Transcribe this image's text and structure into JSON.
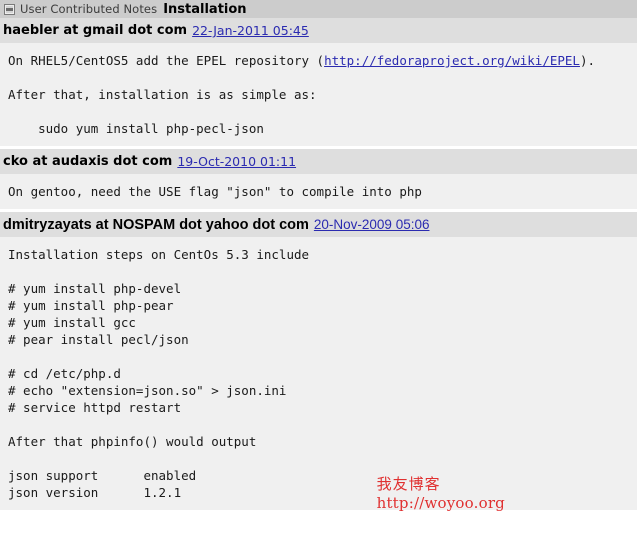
{
  "header": {
    "collapse_icon": "minus-box-icon",
    "notes_label": "User Contributed Notes",
    "page_title": "Installation"
  },
  "notes": [
    {
      "author": "haebler at gmail dot com",
      "date": "22-Jan-2011 05:45",
      "body_before_link": "On RHEL5/CentOS5 add the EPEL repository (",
      "link_text": "http://fedoraproject.org/wiki/EPEL",
      "body_after_link": ").\n\nAfter that, installation is as simple as:\n\n    sudo yum install php-pecl-json"
    },
    {
      "author": "cko at audaxis dot com",
      "date": "19-Oct-2010 01:11",
      "body": "On gentoo, need the USE flag \"json\" to compile into php"
    },
    {
      "author": "dmitryzayats at NOSPAM dot yahoo dot com",
      "date": "20-Nov-2009 05:06",
      "body": "Installation steps on CentOs 5.3 include\n\n# yum install php-devel\n# yum install php-pear\n# yum install gcc\n# pear install pecl/json\n\n# cd /etc/php.d\n# echo \"extension=json.so\" > json.ini\n# service httpd restart\n\nAfter that phpinfo() would output\n\njson support      enabled\njson version      1.2.1"
    }
  ],
  "watermark": {
    "line1": "我友博客",
    "line2": "http://woyoo.org",
    "color": "#e03030"
  },
  "colors": {
    "title_bar": "#cccccc",
    "note_head": "#dedede",
    "note_body": "#f0f0f0",
    "link": "#2b2bb0"
  }
}
